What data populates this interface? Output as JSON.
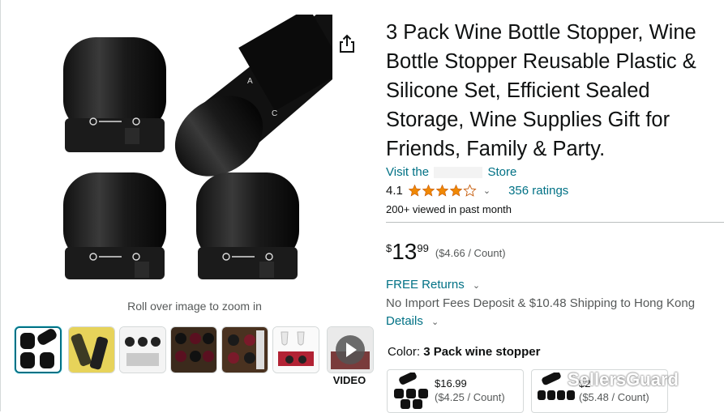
{
  "gallery": {
    "zoom_hint": "Roll over image to zoom in",
    "video_label": "VIDEO",
    "thumbnails": [
      "stopper-set",
      "bottles-yellow",
      "instructions",
      "wine-rack",
      "wine-rack-2",
      "glasses-gift",
      "video"
    ]
  },
  "product": {
    "title": "3 Pack Wine Bottle Stopper, Wine Bottle Stopper Reusable Plastic & Silicone Set, Efficient Sealed Storage, Wine Supplies Gift for Friends, Family & Party.",
    "store_prefix": "Visit the",
    "store_suffix": "Store",
    "rating_value": "4.1",
    "rating_stars": 4.1,
    "ratings_count": "356 ratings",
    "viewed": "200+ viewed in past month",
    "price_currency": "$",
    "price_whole": "13",
    "price_fraction": "99",
    "price_per_unit": "($4.66 / Count)",
    "free_returns": "FREE Returns",
    "shipping": "No Import Fees Deposit & $10.48 Shipping to Hong Kong",
    "details": "Details",
    "color_label": "Color:",
    "color_value": "3 Pack wine stopper",
    "options": [
      {
        "price": "$16.99",
        "unit": "($4.25 / Count)"
      },
      {
        "price": "$2",
        "unit": "($5.48 / Count)"
      }
    ]
  },
  "overlay": {
    "watermark": "SellersGuard"
  },
  "colors": {
    "link": "#007185",
    "star": "#f08804",
    "text": "#0f1111"
  }
}
